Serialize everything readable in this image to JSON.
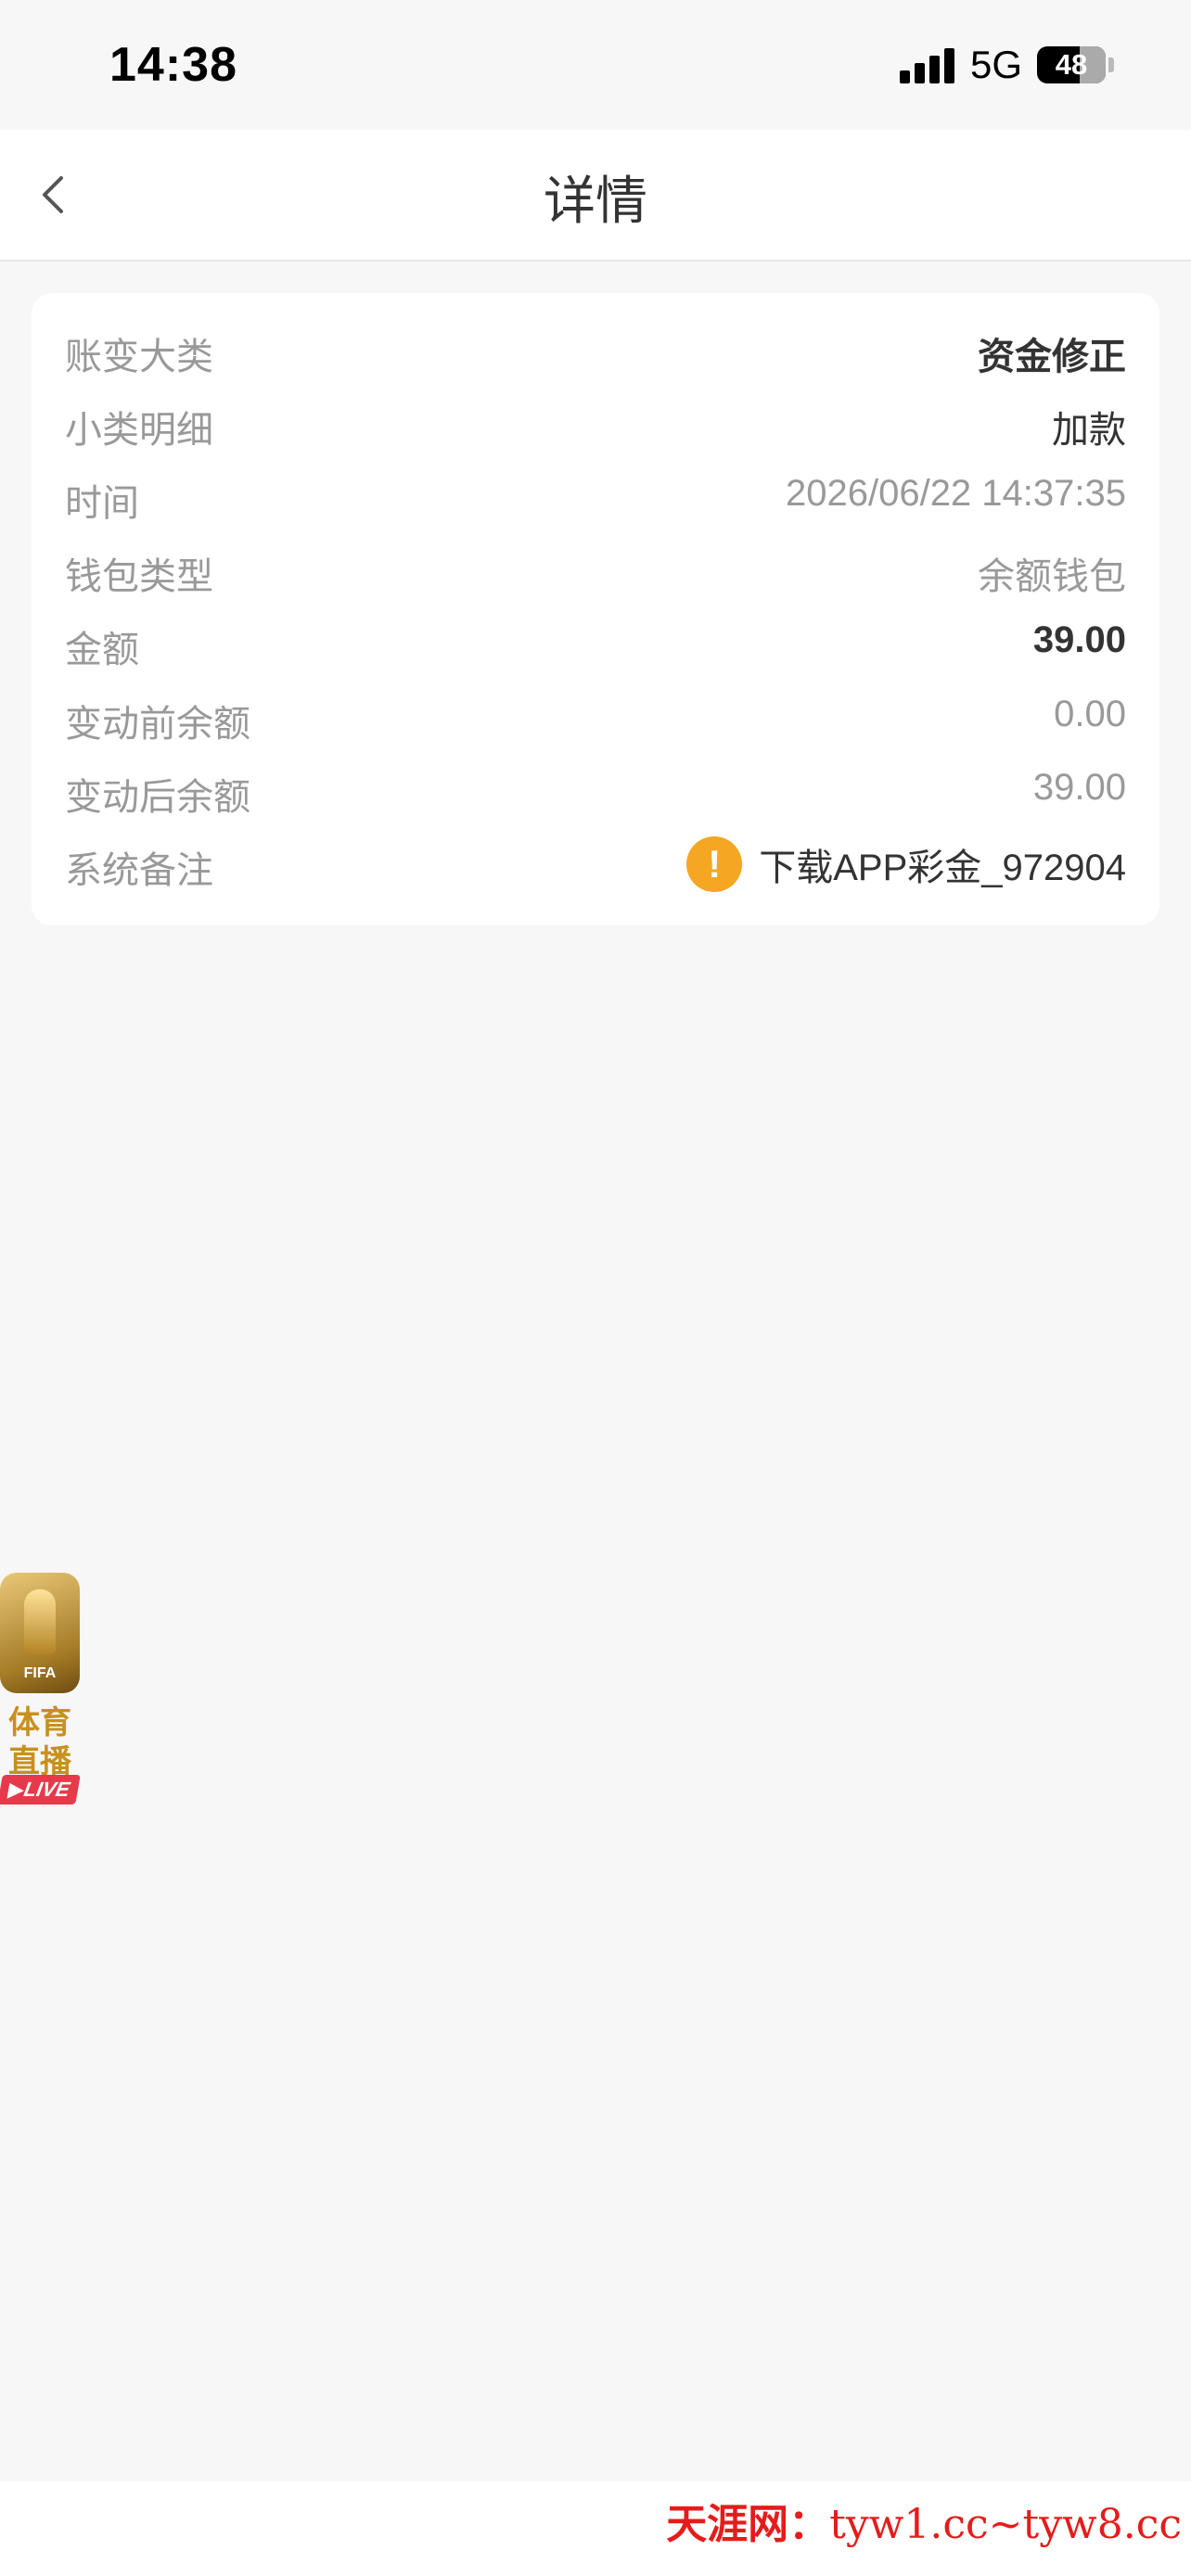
{
  "status_bar": {
    "time": "14:38",
    "network": "5G",
    "battery": "48"
  },
  "nav": {
    "title": "详情",
    "back_icon": "chevron-left-icon"
  },
  "details": [
    {
      "label": "账变大类",
      "value": "资金修正",
      "style": "strong"
    },
    {
      "label": "小类明细",
      "value": "加款",
      "style": "dark"
    },
    {
      "label": "时间",
      "value": "2026/06/22 14:37:35",
      "style": "muted"
    },
    {
      "label": "钱包类型",
      "value": "余额钱包",
      "style": "muted"
    },
    {
      "label": "金额",
      "value": "39.00",
      "style": "strong"
    },
    {
      "label": "变动前余额",
      "value": "0.00",
      "style": "muted"
    },
    {
      "label": "变动后余额",
      "value": "39.00",
      "style": "muted"
    }
  ],
  "remark": {
    "label": "系统备注",
    "value": "下载APP彩金_972904",
    "icon": "warning-icon",
    "icon_glyph": "!",
    "accent": "#f5a623"
  },
  "promo": {
    "badge": "FIFA",
    "line1": "体育",
    "line2": "直播",
    "live": "▶LIVE"
  },
  "watermark": {
    "name": "天涯网：",
    "domains": "tyw1.cc~tyw8.cc"
  }
}
